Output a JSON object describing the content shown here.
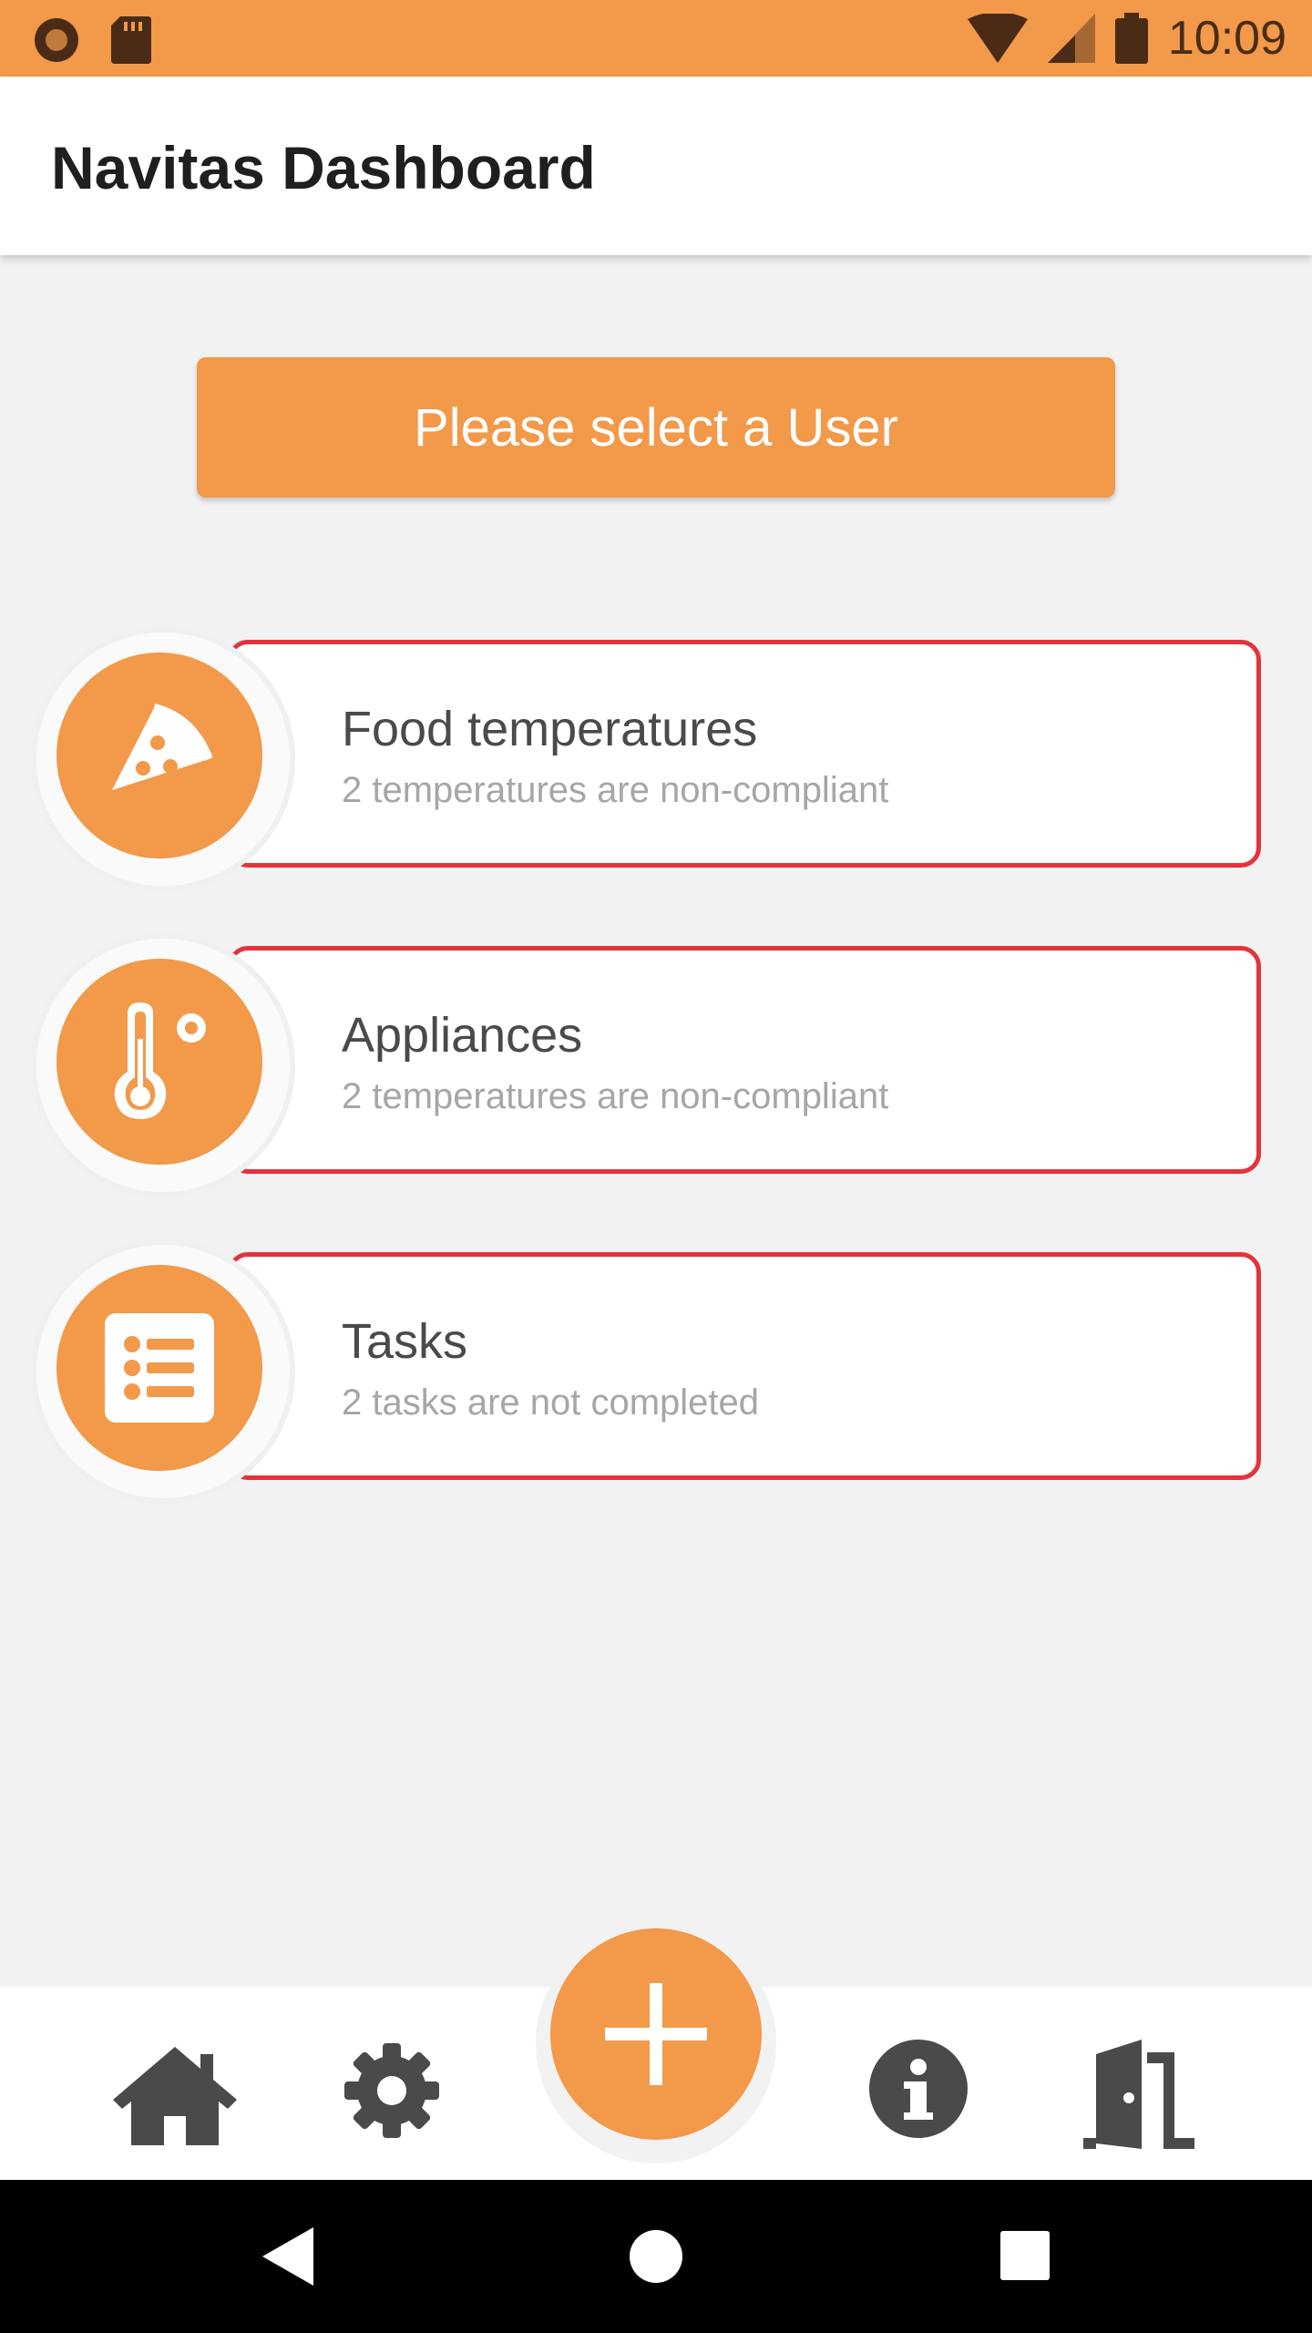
{
  "status_bar": {
    "time": "10:09",
    "icons": [
      "record-icon",
      "sd-card-icon",
      "wifi-icon",
      "signal-icon",
      "battery-icon"
    ]
  },
  "app_bar": {
    "title": "Navitas Dashboard"
  },
  "select_user_button": {
    "label": "Please select a User"
  },
  "cards": [
    {
      "title": "Food temperatures",
      "subtitle": "2 temperatures are non-compliant",
      "icon": "pizza-icon"
    },
    {
      "title": "Appliances",
      "subtitle": "2 temperatures are non-compliant",
      "icon": "thermometer-icon"
    },
    {
      "title": "Tasks",
      "subtitle": "2 tasks are not completed",
      "icon": "task-list-icon"
    }
  ],
  "bottom_nav": {
    "items": [
      "home-icon",
      "settings-icon",
      "add-icon",
      "info-icon",
      "logout-door-icon"
    ]
  },
  "system_nav": [
    "back-icon",
    "home-circle-icon",
    "recents-icon"
  ],
  "colors": {
    "accent": "#f2994a",
    "alert_border": "#e5323b",
    "background": "#f2f2f2",
    "icon_dark": "#4a4a4a"
  }
}
